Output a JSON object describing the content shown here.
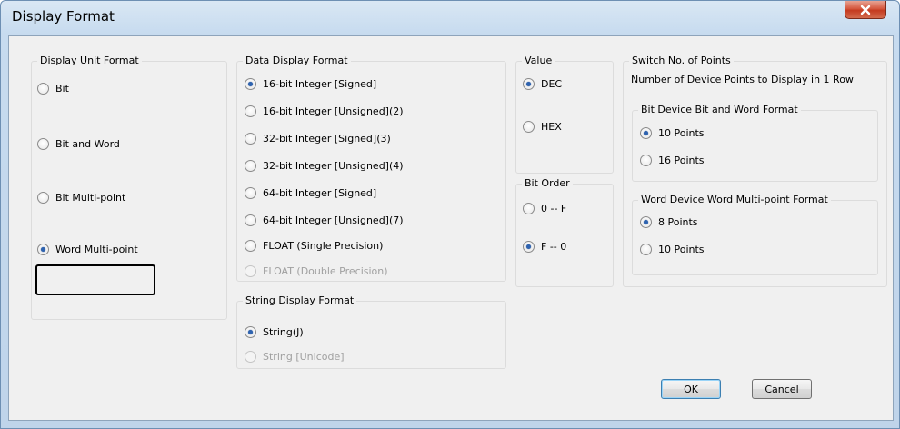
{
  "window": {
    "title": "Display Format",
    "close_label": "x"
  },
  "display_unit_format": {
    "title": "Display Unit Format",
    "options": [
      {
        "label": "Bit",
        "selected": false
      },
      {
        "label": "Bit and Word",
        "selected": false
      },
      {
        "label": "Bit Multi-point",
        "selected": false
      },
      {
        "label": "Word Multi-point",
        "selected": true
      }
    ]
  },
  "data_display_format": {
    "title": "Data Display Format",
    "options": [
      {
        "label": "16-bit Integer [Signed]",
        "selected": true,
        "enabled": true
      },
      {
        "label": "16-bit Integer [Unsigned](2)",
        "selected": false,
        "enabled": true
      },
      {
        "label": "32-bit Integer [Signed](3)",
        "selected": false,
        "enabled": true
      },
      {
        "label": "32-bit Integer [Unsigned](4)",
        "selected": false,
        "enabled": true
      },
      {
        "label": "64-bit Integer [Signed]",
        "selected": false,
        "enabled": true
      },
      {
        "label": "64-bit Integer [Unsigned](7)",
        "selected": false,
        "enabled": true
      },
      {
        "label": "FLOAT (Single Precision)",
        "selected": false,
        "enabled": true
      },
      {
        "label": "FLOAT (Double Precision)",
        "selected": false,
        "enabled": false
      }
    ]
  },
  "string_display_format": {
    "title": "String Display Format",
    "options": [
      {
        "label": "String(J)",
        "selected": true,
        "enabled": true
      },
      {
        "label": "String [Unicode]",
        "selected": false,
        "enabled": false
      }
    ]
  },
  "value": {
    "title": "Value",
    "options": [
      {
        "label": "DEC",
        "selected": true
      },
      {
        "label": "HEX",
        "selected": false
      }
    ]
  },
  "bit_order": {
    "title": "Bit Order",
    "options": [
      {
        "label": "0 -- F",
        "selected": false
      },
      {
        "label": "F -- 0",
        "selected": true
      }
    ]
  },
  "switch_points": {
    "title": "Switch No. of Points",
    "description": "Number of Device Points to Display in 1 Row",
    "bit_device": {
      "title": "Bit Device Bit and Word Format",
      "options": [
        {
          "label": "10 Points",
          "selected": true
        },
        {
          "label": "16 Points",
          "selected": false
        }
      ]
    },
    "word_device": {
      "title": "Word Device Word Multi-point Format",
      "options": [
        {
          "label": "8 Points",
          "selected": true
        },
        {
          "label": "10 Points",
          "selected": false
        }
      ]
    }
  },
  "buttons": {
    "ok_label": "OK",
    "cancel_label": "Cancel"
  },
  "colors": {
    "selected_dot": "#2e63b0",
    "highlight_border": "#000000",
    "close_button": "#c43a1f"
  }
}
